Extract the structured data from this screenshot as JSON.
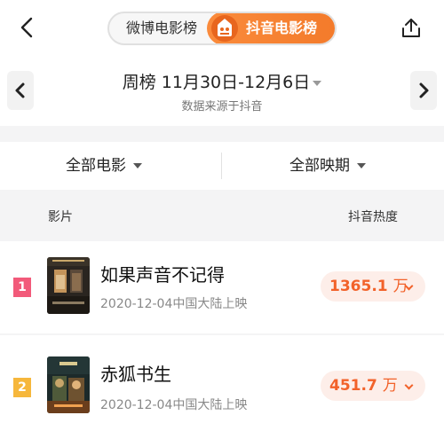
{
  "nav": {
    "tabs": [
      "微博电影榜",
      "抖音电影榜"
    ],
    "active_tab_index": 1,
    "back_icon": "chevron-left-icon",
    "share_icon": "share-icon"
  },
  "week": {
    "title": "周榜 11月30日-12月6日",
    "source": "数据来源于抖音"
  },
  "filters": {
    "genre": "全部电影",
    "period": "全部映期"
  },
  "columns": {
    "film": "影片",
    "heat": "抖音热度"
  },
  "rows": [
    {
      "rank": "1",
      "title": "如果声音不记得",
      "date": "2020-12-04中国大陆上映",
      "heat_value": "1365.1",
      "heat_unit": "万",
      "rank_color": "#f25a7a"
    },
    {
      "rank": "2",
      "title": "赤狐书生",
      "date": "2020-12-04中国大陆上映",
      "heat_value": "451.7",
      "heat_unit": "万",
      "rank_color": "#f6b73c"
    }
  ],
  "colors": {
    "accent": "#f37a2a",
    "heat_text": "#f2622a",
    "heat_bg": "#fdeee9"
  }
}
